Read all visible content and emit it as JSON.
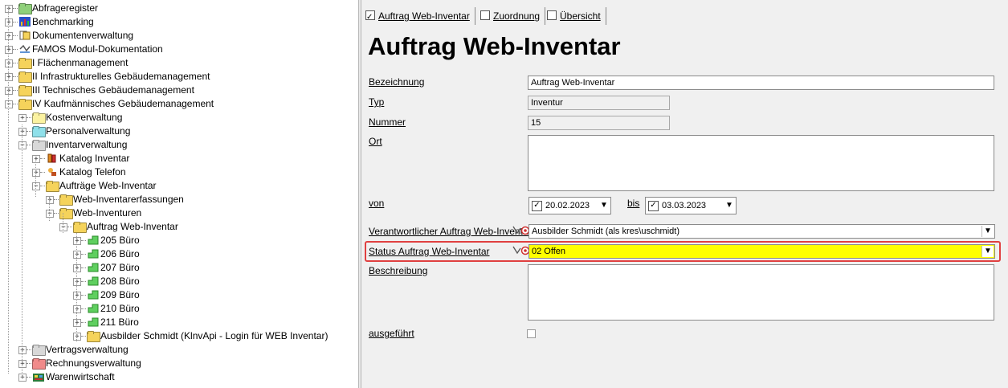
{
  "tree": {
    "items": [
      {
        "label": "Abfrageregister",
        "sign": "+",
        "icon": "folder-icon"
      },
      {
        "label": "Benchmarking",
        "sign": "+",
        "icon": "benchmarking-icon"
      },
      {
        "label": "Dokumentenverwaltung",
        "sign": "+",
        "icon": "documents-icon"
      },
      {
        "label": "FAMOS Modul-Dokumentation",
        "sign": "+",
        "icon": "documentation-icon"
      },
      {
        "label": "I   Flächenmanagement",
        "sign": "+",
        "icon": "folder-icon"
      },
      {
        "label": "II  Infrastrukturelles Gebäudemanagement",
        "sign": "+",
        "icon": "folder-icon"
      },
      {
        "label": "III Technisches Gebäudemanagement",
        "sign": "+",
        "icon": "folder-icon"
      },
      {
        "label": "IV Kaufmännisches Gebäudemanagement",
        "sign": "-",
        "icon": "folder-open-icon"
      },
      {
        "label": "Kostenverwaltung",
        "sign": "+",
        "icon": "folder-icon"
      },
      {
        "label": "Personalverwaltung",
        "sign": "+",
        "icon": "folder-icon"
      },
      {
        "label": "Inventarverwaltung",
        "sign": "-",
        "icon": "folder-open-icon"
      },
      {
        "label": "Katalog Inventar",
        "sign": "+",
        "icon": "catalog-icon"
      },
      {
        "label": "Katalog Telefon",
        "sign": "+",
        "icon": "phone-catalog-icon"
      },
      {
        "label": "Aufträge Web-Inventar",
        "sign": "-",
        "icon": "folder-open-icon"
      },
      {
        "label": "Web-Inventarerfassungen",
        "sign": "+",
        "icon": "folder-icon"
      },
      {
        "label": "Web-Inventuren",
        "sign": "-",
        "icon": "folder-open-icon"
      },
      {
        "label": "Auftrag Web-Inventar",
        "sign": "-",
        "icon": "folder-open-icon"
      },
      {
        "label": "205 Büro",
        "sign": "+",
        "icon": "room-icon"
      },
      {
        "label": "206 Büro",
        "sign": "+",
        "icon": "room-icon"
      },
      {
        "label": "207 Büro",
        "sign": "+",
        "icon": "room-icon"
      },
      {
        "label": "208 Büro",
        "sign": "+",
        "icon": "room-icon"
      },
      {
        "label": "209 Büro",
        "sign": "+",
        "icon": "room-icon"
      },
      {
        "label": "210 Büro",
        "sign": "+",
        "icon": "room-icon"
      },
      {
        "label": "211 Büro",
        "sign": "+",
        "icon": "room-icon"
      },
      {
        "label": "Ausbilder Schmidt (KlnvApi - Login für WEB Inventar)",
        "sign": "+",
        "icon": "folder-icon"
      },
      {
        "label": "Vertragsverwaltung",
        "sign": "+",
        "icon": "folder-icon"
      },
      {
        "label": "Rechnungsverwaltung",
        "sign": "+",
        "icon": "folder-icon"
      },
      {
        "label": "Warenwirtschaft",
        "sign": "+",
        "icon": "warehouse-icon"
      }
    ]
  },
  "tabs": [
    {
      "label": "Auftrag Web-Inventar",
      "checked": true
    },
    {
      "label": "Zuordnung",
      "checked": false
    },
    {
      "label": "Übersicht",
      "checked": false
    }
  ],
  "form": {
    "title": "Auftrag Web-Inventar",
    "bezeichnung_label": "Bezeichnung",
    "bezeichnung_value": "Auftrag Web-Inventar",
    "typ_label": "Typ",
    "typ_value": "Inventur",
    "nummer_label": "Nummer",
    "nummer_value": "15",
    "ort_label": "Ort",
    "ort_value": "",
    "von_label": "von",
    "von_value": "20.02.2023",
    "bis_label": "bis",
    "bis_value": "03.03.2023",
    "verantwortlicher_label": "Verantwortlicher Auftrag Web-Inventar",
    "verantwortlicher_value": "Ausbilder Schmidt (als kres\\uschmidt)",
    "status_label": "Status Auftrag Web-Inventar",
    "status_value": "02 Offen",
    "beschreibung_label": "Beschreibung",
    "beschreibung_value": "",
    "ausgefuehrt_label": "ausgeführt",
    "ausgefuehrt_checked": false
  },
  "colors": {
    "status_highlight": "#ffff00",
    "selection_border": "#e04040"
  }
}
